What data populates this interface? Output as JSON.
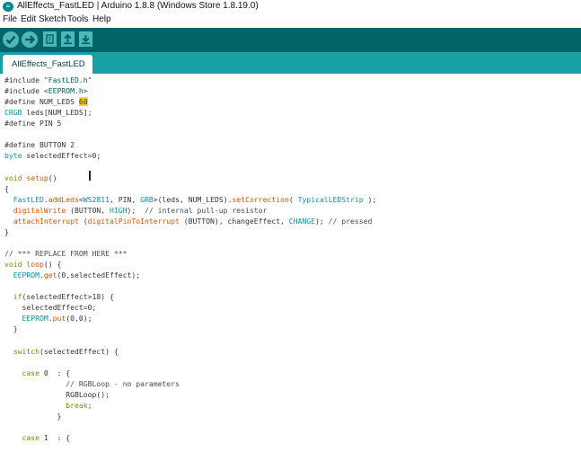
{
  "window": {
    "title": "AllEffects_FastLED | Arduino 1.8.8 (Windows Store 1.8.19.0)",
    "logo_text": "∞"
  },
  "menu": [
    "File",
    "Edit",
    "Sketch",
    "Tools",
    "Help"
  ],
  "toolbar": {
    "buttons": [
      "verify-icon",
      "upload-icon",
      "new-icon",
      "open-icon",
      "save-icon"
    ]
  },
  "tabs": [
    {
      "label": "AllEffects_FastLED"
    }
  ],
  "editor": {
    "lines": [
      "#include \"FastLED.h\"",
      "#include <EEPROM.h>",
      "#define NUM_LEDS 60",
      "CRGB leds[NUM_LEDS];",
      "#define PIN 5",
      "",
      "#define BUTTON 2",
      "byte selectedEffect=0;",
      "",
      "void setup()",
      "{",
      "  FastLED.addLeds<WS2811, PIN, GRB>(leds, NUM_LEDS).setCorrection( TypicalLEDStrip );",
      "  digitalWrite (BUTTON, HIGH);  // internal pull-up resistor",
      "  attachInterrupt (digitalPinToInterrupt (BUTTON), changeEffect, CHANGE); // pressed",
      "}",
      "",
      "// *** REPLACE FROM HERE ***",
      "void loop() {",
      "  EEPROM.get(0,selectedEffect);",
      "",
      "  if(selectedEffect>18) {",
      "    selectedEffect=0;",
      "    EEPROM.put(0,0);",
      "  }",
      "",
      "  switch(selectedEffect) {",
      "",
      "    case 0  : {",
      "              // RGBLoop - no parameters",
      "              RGBLoop();",
      "              break;",
      "            }",
      "",
      "    case 1  : {"
    ],
    "highlighted_text": "60",
    "highlighted_line": 3
  },
  "colors": {
    "toolbar": "#006468",
    "tabbar": "#17a1a5",
    "button": "#4db7bb",
    "keyword": "#728e00",
    "type": "#00979c",
    "function": "#d35400",
    "highlight": "#ffcf40"
  }
}
